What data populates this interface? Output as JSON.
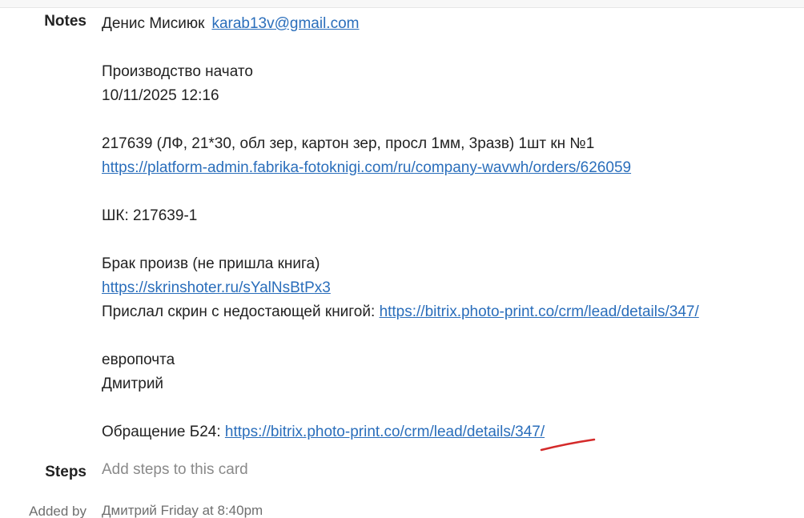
{
  "fields": {
    "notes_label": "Notes",
    "steps_label": "Steps",
    "added_by_label": "Added by"
  },
  "notes": {
    "author_name": "Денис Мисиюк",
    "author_email": "karab13v@gmail.com",
    "production_status": "Производство начато",
    "production_datetime": "10/11/2025 12:16",
    "order_description": "217639 (ЛФ, 21*30, обл зер, картон зер, просл 1мм, 3разв) 1шт кн №1",
    "order_link": "https://platform-admin.fabrika-fotoknigi.com/ru/company-wavwh/orders/626059",
    "barcode": "ШК: 217639-1",
    "defect_text": "Брак произв (не пришла книга)",
    "screenshot_link": "https://skrinshoter.ru/sYalNsBtPx3",
    "sent_screen_label": "Прислал скрин с недостающей книгой:",
    "sent_screen_link": "https://bitrix.photo-print.co/crm/lead/details/347/",
    "delivery": "европочта",
    "person": "Дмитрий",
    "request_label": "Обращение Б24:",
    "request_link": "https://bitrix.photo-print.co/crm/lead/details/347/"
  },
  "steps": {
    "placeholder": "Add steps to this card"
  },
  "added_by": {
    "value": "Дмитрий Friday at 8:40pm"
  },
  "colors": {
    "link": "#2a6ebb",
    "annotation_mark": "#d42a2a"
  }
}
